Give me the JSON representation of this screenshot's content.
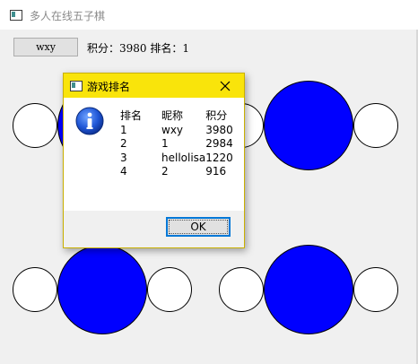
{
  "window": {
    "title": "多人在线五子棋"
  },
  "header": {
    "username": "wxy",
    "score_text": "积分：3980  排名：1"
  },
  "colors": {
    "dialog_titlebar": "#f9e40b",
    "player_blue": "#0000ff",
    "player_white": "#ffffff",
    "client_background": "#f0f0f0",
    "ok_border": "#0078d7"
  },
  "dialog": {
    "title": "游戏排名",
    "icon": "info-icon",
    "close_icon": "close-icon",
    "columns": [
      "排名",
      "昵称",
      "积分"
    ],
    "rows": [
      [
        "1",
        "wxy",
        "3980"
      ],
      [
        "2",
        "1",
        "2984"
      ],
      [
        "3",
        "hellolisa",
        "1220"
      ],
      [
        "4",
        "2",
        "916"
      ]
    ],
    "ok_label": "OK"
  }
}
